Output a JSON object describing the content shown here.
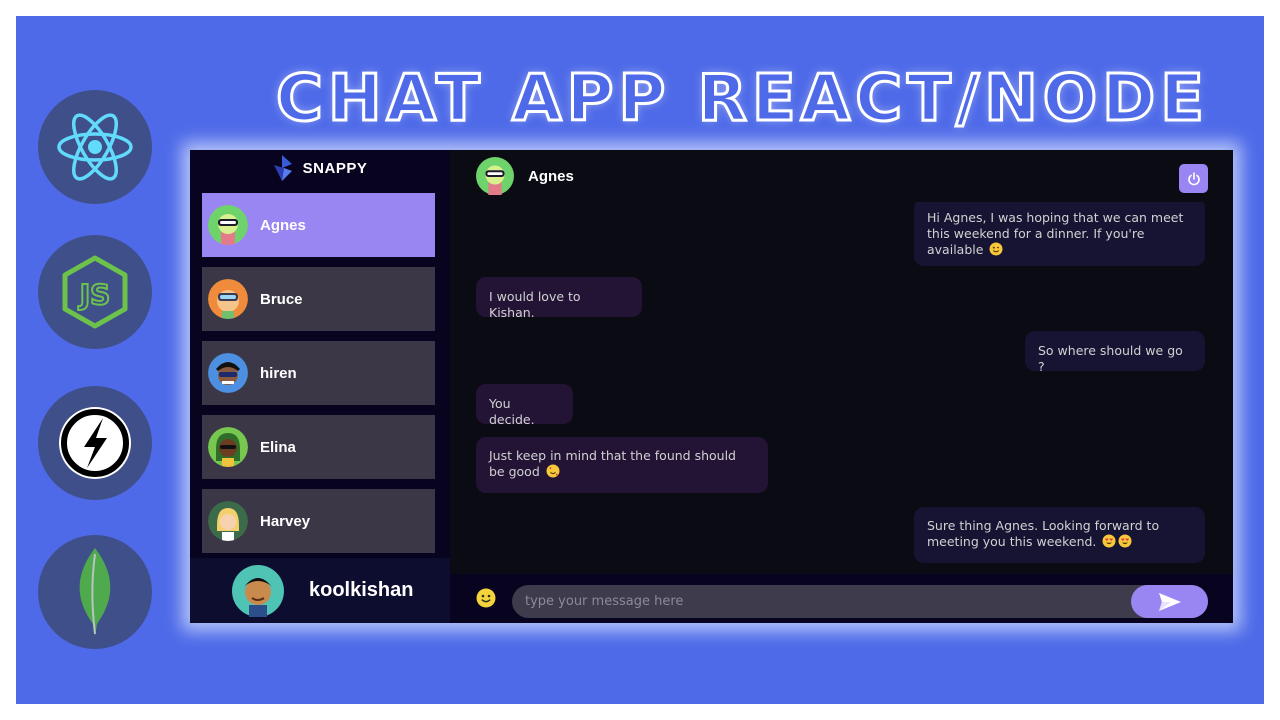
{
  "banner": {
    "title": "CHAT APP REACT/NODE"
  },
  "tech_icons": [
    "react-icon",
    "nodejs-icon",
    "socketio-icon",
    "mongodb-icon"
  ],
  "brand": {
    "name": "SNAPPY",
    "icon": "snappy-logo-icon"
  },
  "contacts": [
    {
      "name": "Agnes",
      "selected": true
    },
    {
      "name": "Bruce",
      "selected": false
    },
    {
      "name": "hiren",
      "selected": false
    },
    {
      "name": "Elina",
      "selected": false
    },
    {
      "name": "Harvey",
      "selected": false
    }
  ],
  "current_user": {
    "name": "koolkishan"
  },
  "chat": {
    "header_name": "Agnes",
    "logout_icon": "power-icon",
    "messages": [
      {
        "direction": "sent",
        "text": "Hi Agnes, I was hoping that we can meet this weekend for a dinner. If you're available",
        "emoji": "wink-emoji"
      },
      {
        "direction": "received",
        "text": "I would love to Kishan."
      },
      {
        "direction": "sent",
        "text": "So where should we go ?"
      },
      {
        "direction": "received",
        "text": "You decide."
      },
      {
        "direction": "received",
        "text": "Just keep in mind that the found should be good",
        "emoji": "hearts-face-emoji"
      },
      {
        "direction": "sent",
        "text": "Sure thing Agnes. Looking forward to meeting you this weekend.",
        "emoji": "heart-eyes-emoji x2"
      }
    ]
  },
  "input": {
    "placeholder": "type your message here",
    "value": "",
    "emoji_icon": "smiley-icon",
    "send_icon": "send-icon"
  },
  "colors": {
    "frame": "#4e6ae8",
    "app_bg": "#0b0b14",
    "sidebar_bg": "#080420",
    "contact_bg": "#3b3747",
    "accent": "#9a86f3",
    "sent_bubble": "#171433",
    "received_bubble": "#231436",
    "input_bg": "#3e3b4c"
  }
}
